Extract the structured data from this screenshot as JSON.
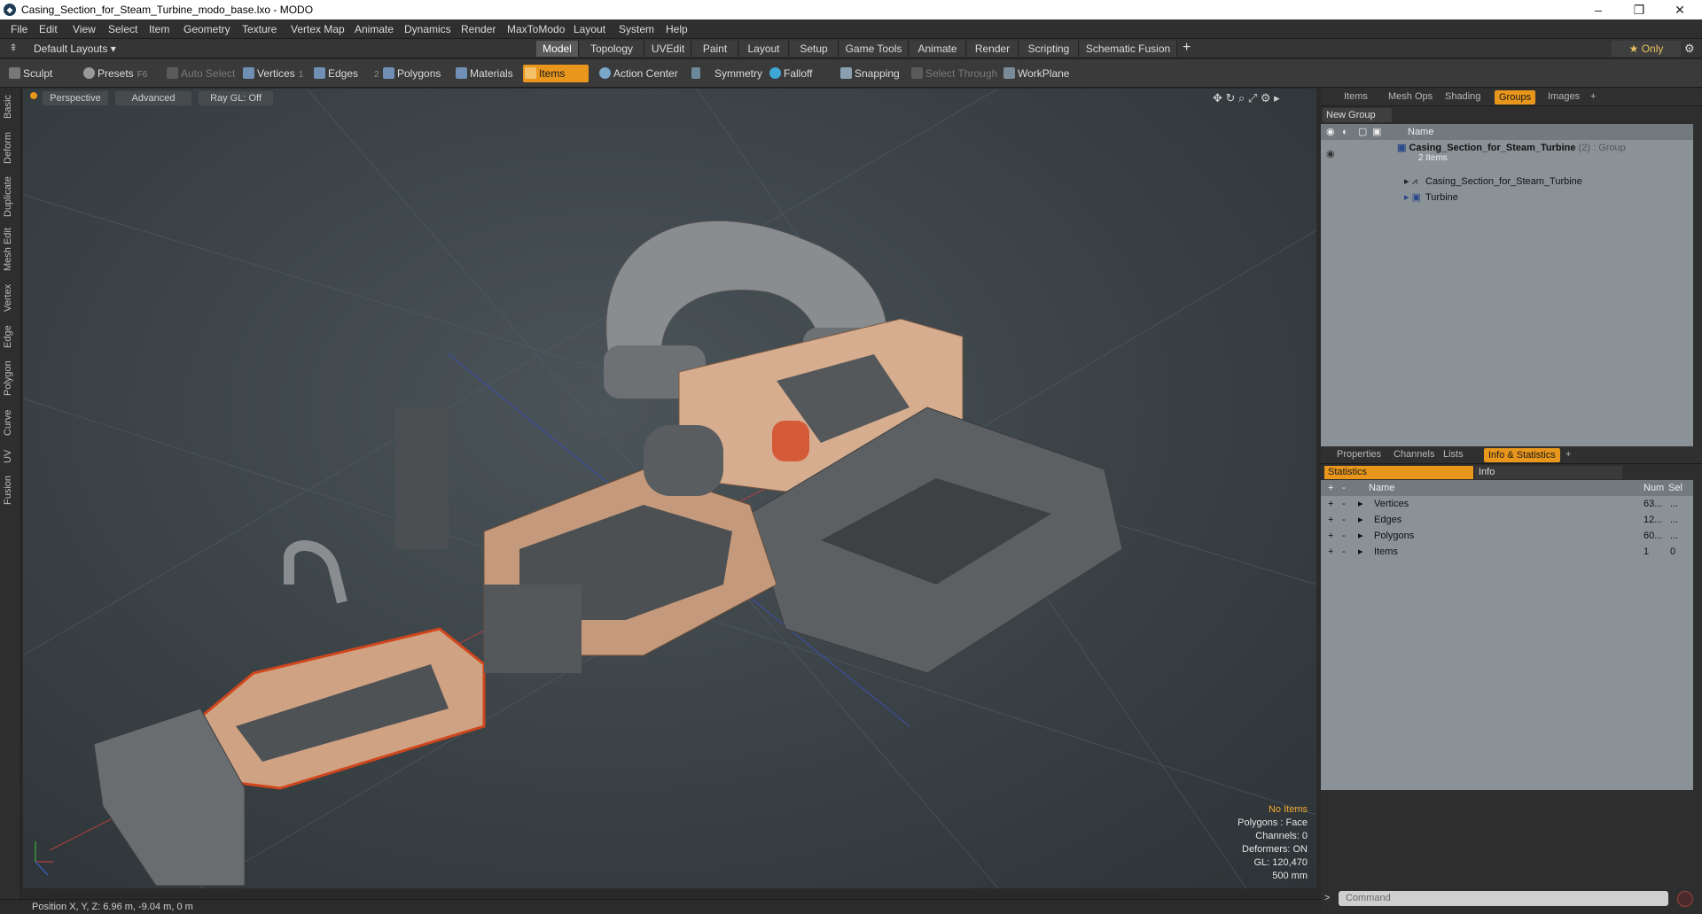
{
  "window": {
    "title": "Casing_Section_for_Steam_Turbine_modo_base.lxo - MODO",
    "controls": [
      "–",
      "❐",
      "✕"
    ]
  },
  "menu": [
    "File",
    "Edit",
    "View",
    "Select",
    "Item",
    "Geometry",
    "Texture",
    "Vertex Map",
    "Animate",
    "Dynamics",
    "Render",
    "MaxToModo",
    "Layout",
    "System",
    "Help"
  ],
  "layouts": {
    "label": "Default Layouts ▾",
    "tabs": [
      "Model",
      "Topology",
      "UVEdit",
      "Paint",
      "Layout",
      "Setup",
      "Game Tools",
      "Animate",
      "Render",
      "Scripting",
      "Schematic Fusion"
    ],
    "active": "Model",
    "add": "+",
    "only": "★  Only",
    "settings": "⚙"
  },
  "toolbar": {
    "sculpt": "Sculpt",
    "presets": "Presets",
    "presets_key": "F6",
    "auto_select": "Auto Select",
    "vertices": "Vertices",
    "vertices_n": "1",
    "edges": "Edges",
    "edges_n": "2",
    "polygons": "Polygons",
    "materials": "Materials",
    "items": "Items",
    "action_center": "Action Center",
    "symmetry": "Symmetry",
    "falloff": "Falloff",
    "snapping": "Snapping",
    "select_through": "Select Through",
    "workplane": "WorkPlane"
  },
  "left_tabs": [
    "Basic",
    "Deform",
    "Duplicate",
    "Mesh Edit",
    "Vertex",
    "Edge",
    "Polygon",
    "Curve",
    "UV",
    "Fusion"
  ],
  "viewport": {
    "perspective": "Perspective",
    "advanced": "Advanced",
    "raygl": "Ray GL: Off",
    "icons": "✥ ↻ ⌕ ⤢ ⚙ ▸",
    "info": {
      "l1": "No Items",
      "l2": "Polygons : Face",
      "l3": "Channels: 0",
      "l4": "Deformers: ON",
      "l5": "GL: 120,470",
      "l6": "500 mm"
    }
  },
  "status": {
    "position": "Position X, Y, Z:  6.96 m, -9.04 m, 0 m"
  },
  "scene_panel": {
    "tabs": [
      "Items",
      "Mesh Ops",
      "Shading",
      "Groups",
      "Images",
      "+"
    ],
    "active": "Groups",
    "new_group": "New Group",
    "col_name": "Name",
    "group": {
      "name": "Casing_Section_for_Steam_Turbine",
      "count": "(2)",
      "kind": ": Group",
      "sub": "2 Items"
    },
    "children": [
      "Casing_Section_for_Steam_Turbine",
      "Turbine"
    ]
  },
  "stats_panel": {
    "tabs": [
      "Properties",
      "Channels",
      "Lists",
      "Info & Statistics",
      "+"
    ],
    "active": "Info & Statistics",
    "sub_tabs": [
      "Statistics",
      "Info"
    ],
    "cols": [
      "Name",
      "Num",
      "Sel"
    ],
    "rows": [
      {
        "name": "Vertices",
        "num": "63...",
        "sel": "..."
      },
      {
        "name": "Edges",
        "num": "12...",
        "sel": "..."
      },
      {
        "name": "Polygons",
        "num": "60...",
        "sel": "..."
      },
      {
        "name": "Items",
        "num": "1",
        "sel": "0"
      }
    ]
  },
  "command": {
    "placeholder": "Command"
  }
}
